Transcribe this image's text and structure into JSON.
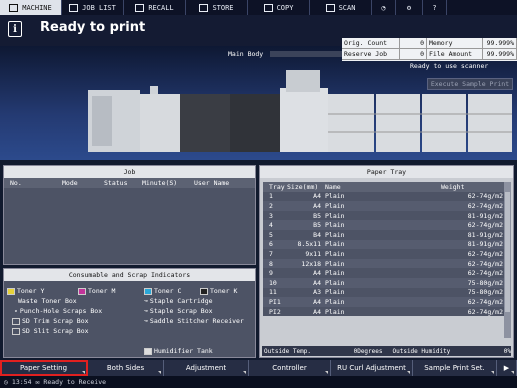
{
  "tabs": [
    {
      "label": "MACHINE",
      "icon": "machine-icon",
      "active": true
    },
    {
      "label": "JOB LIST",
      "icon": "job-list-icon"
    },
    {
      "label": "RECALL",
      "icon": "recall-icon"
    },
    {
      "label": "STORE",
      "icon": "store-icon"
    },
    {
      "label": "COPY",
      "icon": "copy-icon"
    },
    {
      "label": "SCAN",
      "icon": "scan-icon"
    },
    {
      "label": "",
      "icon": "globe-icon"
    },
    {
      "label": "",
      "icon": "settings-icon"
    },
    {
      "label": "",
      "icon": "help-icon"
    }
  ],
  "status": {
    "text": "Ready to print",
    "main_body": "Main Body",
    "scanner": "Ready to use scanner",
    "execute_sample": "Execute Sample Print"
  },
  "counters": {
    "orig_count_label": "Orig. Count",
    "orig_count": "0",
    "memory_label": "Memory",
    "memory": "99.999%",
    "reserve_job_label": "Reserve Job",
    "reserve_job": "0",
    "file_amount_label": "File Amount",
    "file_amount": "99.999%"
  },
  "job": {
    "title": "Job",
    "cols": [
      "No.",
      "Mode",
      "Status",
      "Minute(S)",
      "User Name"
    ]
  },
  "consumables": {
    "title": "Consumable and Scrap Indicators",
    "items": [
      "Toner Y",
      "Toner M",
      "Toner C",
      "Toner K",
      "Waste Toner Box",
      "Staple Cartridge",
      "Punch-Hole Scraps Box",
      "Staple Scrap Box",
      "SD Trim Scrap Box",
      "Saddle Stitcher Receiver",
      "SD Slit Scrap Box",
      "Humidifier Tank"
    ]
  },
  "tray": {
    "title": "Paper Tray",
    "cols": [
      "Tray",
      "Size(mm)",
      "Name",
      "Weight"
    ],
    "rows": [
      [
        "1",
        "A4",
        "Plain",
        "62-74g/m2"
      ],
      [
        "2",
        "A4",
        "Plain",
        "62-74g/m2"
      ],
      [
        "3",
        "B5",
        "Plain",
        "81-91g/m2"
      ],
      [
        "4",
        "B5",
        "Plain",
        "62-74g/m2"
      ],
      [
        "5",
        "B4",
        "Plain",
        "81-91g/m2"
      ],
      [
        "6",
        "8.5x11",
        "Plain",
        "81-91g/m2"
      ],
      [
        "7",
        "9x11",
        "Plain",
        "62-74g/m2"
      ],
      [
        "8",
        "12x18",
        "Plain",
        "62-74g/m2"
      ],
      [
        "9",
        "A4",
        "Plain",
        "62-74g/m2"
      ],
      [
        "10",
        "A4",
        "Plain",
        "75-80g/m2"
      ],
      [
        "11",
        "A3",
        "Plain",
        "75-80g/m2"
      ],
      [
        "PI1",
        "A4",
        "Plain",
        "62-74g/m2"
      ],
      [
        "PI2",
        "A4",
        "Plain",
        "62-74g/m2"
      ]
    ],
    "outside_temp_label": "Outside Temp.",
    "outside_temp": "0Degrees",
    "outside_humidity_label": "Outside Humidity",
    "outside_humidity": "0%"
  },
  "bottom_tabs": [
    "Paper Setting",
    "Both Sides",
    "Adjustment",
    "Controller",
    "RU Curl Adjustment",
    "Sample Print Set."
  ],
  "footer": {
    "time": "13:54",
    "message": "Ready to Receive"
  },
  "colors": {
    "selected_outline": "#e02020",
    "background": "#111a2e"
  }
}
